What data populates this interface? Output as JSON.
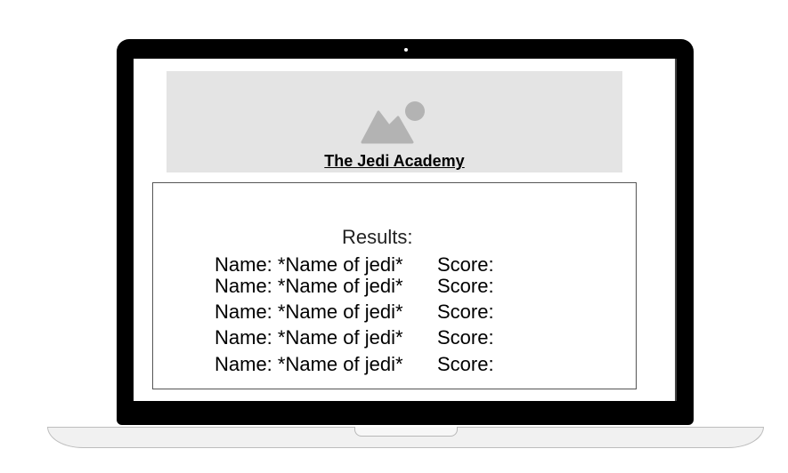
{
  "header": {
    "title": "The Jedi Academy",
    "image_icon": "image-placeholder-icon"
  },
  "results": {
    "heading": "Results:",
    "rows": [
      {
        "name": "Name: *Name of jedi*",
        "score": "Score:"
      },
      {
        "name": "Name: *Name of jedi*",
        "score": "Score:"
      },
      {
        "name": "Name: *Name of jedi*",
        "score": "Score:"
      },
      {
        "name": "Name: *Name of jedi*",
        "score": "Score:"
      },
      {
        "name": "Name: *Name of jedi*",
        "score": "Score:"
      }
    ]
  },
  "colors": {
    "bezel": "#000000",
    "banner": "#e4e4e4",
    "icon": "#b3b3b3"
  }
}
